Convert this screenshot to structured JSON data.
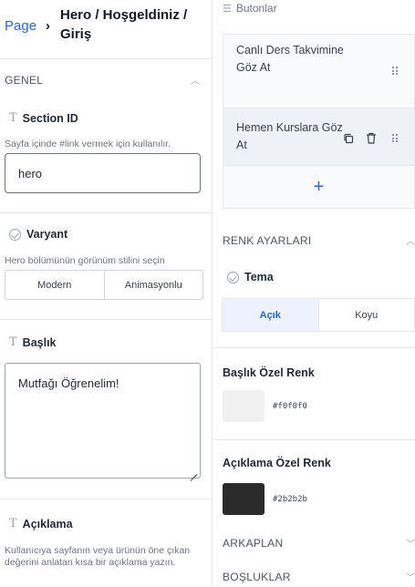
{
  "breadcrumb": {
    "root": "Page",
    "separator": "›",
    "title": "Hero / Hoşgeldiniz / Giriş"
  },
  "general": {
    "header": "GENEL",
    "section_id": {
      "label": "Section ID",
      "help": "Sayfa içinde #link vermek için kullanılır.",
      "value": "hero"
    },
    "variant": {
      "label": "Varyant",
      "help": "Hero bölümünün görünüm stilini seçin",
      "options": [
        "Modern",
        "Animasyonlu"
      ]
    },
    "title_field": {
      "label": "Başlık",
      "value": "Mutfağı Öğrenelim!"
    },
    "description": {
      "label": "Açıklama",
      "help": "Kullanıcıya sayfanın veya ürünün öne çıkan değerini anlatan kısa bir açıklama yazın."
    }
  },
  "buttons": {
    "header": "Butonlar",
    "items": [
      {
        "label": "Canlı Ders Takvimine Göz At"
      },
      {
        "label": "Hemen Kurslara Göz At"
      }
    ],
    "add": "+"
  },
  "colors": {
    "header": "RENK AYARLARI",
    "theme": {
      "label": "Tema",
      "options": [
        "Açık",
        "Koyu"
      ],
      "selected": "Açık"
    },
    "title_color": {
      "label": "Başlık Özel Renk",
      "value": "#f0f0f0"
    },
    "desc_color": {
      "label": "Açıklama Özel Renk",
      "value": "#2b2b2b"
    }
  },
  "background": {
    "header": "ARKAPLAN"
  },
  "spacing": {
    "header": "BOŞLUKLAR"
  },
  "accent": {
    "link": "#2563eb",
    "selected_tab_text": "#2563eb",
    "selected_tab_bg": "#eef2ff"
  }
}
